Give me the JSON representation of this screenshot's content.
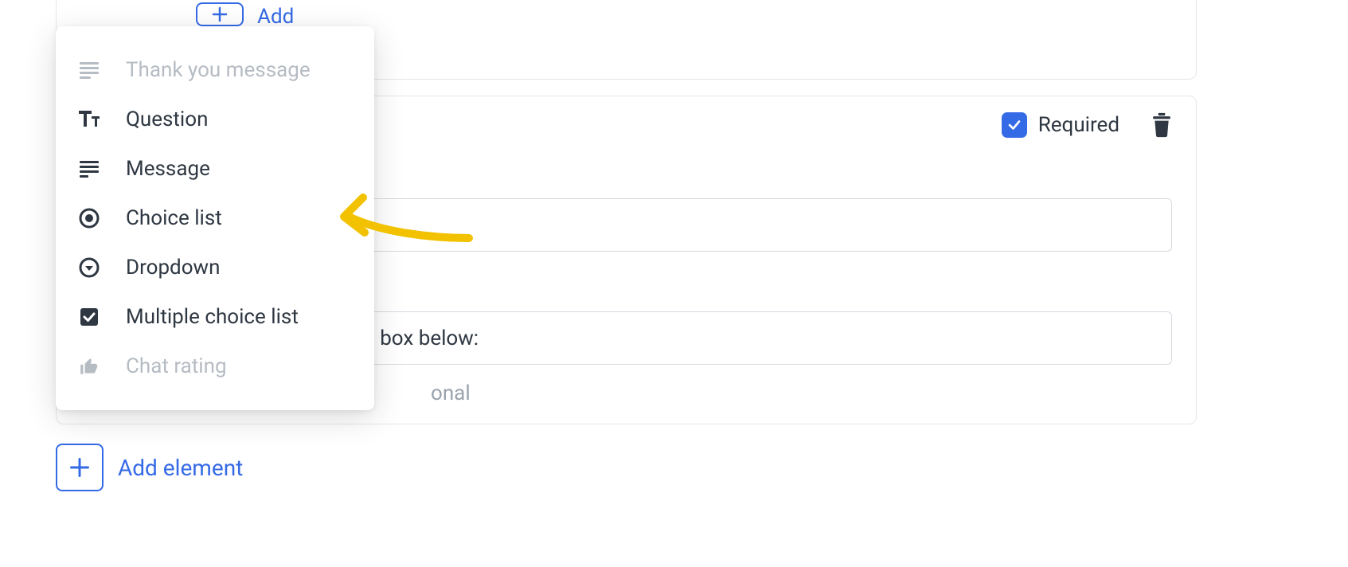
{
  "top": {
    "add_label": "Add"
  },
  "card": {
    "required_label": "Required",
    "required_checked": true,
    "field2_value": "can leave a comment in the box below:",
    "optional_hint": "onal"
  },
  "menu": {
    "items": [
      {
        "label": "Thank you message",
        "disabled": true
      },
      {
        "label": "Question",
        "disabled": false
      },
      {
        "label": "Message",
        "disabled": false
      },
      {
        "label": "Choice list",
        "disabled": false
      },
      {
        "label": "Dropdown",
        "disabled": false
      },
      {
        "label": "Multiple choice list",
        "disabled": false
      },
      {
        "label": "Chat rating",
        "disabled": true
      }
    ]
  },
  "footer": {
    "add_element_label": "Add element"
  }
}
